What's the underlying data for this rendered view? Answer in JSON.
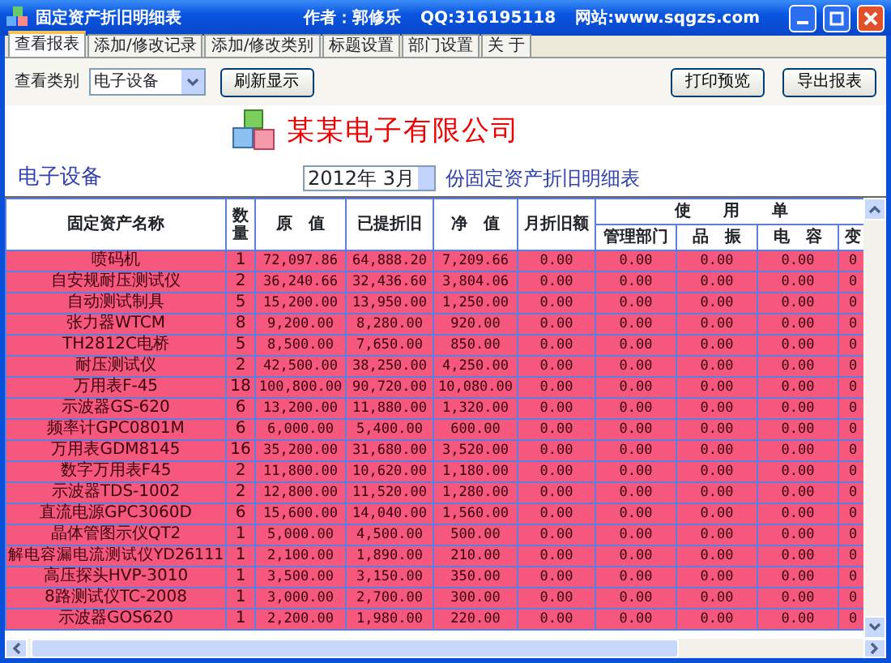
{
  "window": {
    "title": "固定资产折旧明细表",
    "author": "作者：郭修乐",
    "qq": "QQ:316195118",
    "website": "网站:www.sqgzs.com"
  },
  "tabs": [
    {
      "label": "查看报表",
      "selected": true
    },
    {
      "label": "添加/修改记录",
      "selected": false
    },
    {
      "label": "添加/修改类别",
      "selected": false
    },
    {
      "label": "标题设置",
      "selected": false
    },
    {
      "label": "部门设置",
      "selected": false
    },
    {
      "label": "关 于",
      "selected": false
    }
  ],
  "toolbar": {
    "category_label": "查看类别",
    "category_value": "电子设备",
    "refresh_button": "刷新显示",
    "print_preview_button": "打印预览",
    "export_button": "导出报表"
  },
  "report": {
    "company": "某某电子有限公司",
    "category": "电子设备",
    "date": "2012年 3月",
    "subtitle": "份固定资产折旧明细表",
    "table": {
      "columns": [
        "固定资产名称",
        "数量",
        "原　值",
        "已提折旧",
        "净　值",
        "月折旧额"
      ],
      "group_header": "使　　用　　单",
      "subcolumns": [
        "管理部门",
        "品　振",
        "电　容",
        "变"
      ],
      "rows": [
        [
          "喷码机",
          "1",
          "72,097.86",
          "64,888.20",
          "7,209.66",
          "0.00",
          "0.00",
          "0.00",
          "0.00",
          "0"
        ],
        [
          "自安规耐压测试仪",
          "2",
          "36,240.66",
          "32,436.60",
          "3,804.06",
          "0.00",
          "0.00",
          "0.00",
          "0.00",
          "0"
        ],
        [
          "自动测试制具",
          "5",
          "15,200.00",
          "13,950.00",
          "1,250.00",
          "0.00",
          "0.00",
          "0.00",
          "0.00",
          "0"
        ],
        [
          "张力器WTCM",
          "8",
          "9,200.00",
          "8,280.00",
          "920.00",
          "0.00",
          "0.00",
          "0.00",
          "0.00",
          "0"
        ],
        [
          "TH2812C电桥",
          "5",
          "8,500.00",
          "7,650.00",
          "850.00",
          "0.00",
          "0.00",
          "0.00",
          "0.00",
          "0"
        ],
        [
          "耐压测试仪",
          "2",
          "42,500.00",
          "38,250.00",
          "4,250.00",
          "0.00",
          "0.00",
          "0.00",
          "0.00",
          "0"
        ],
        [
          "万用表F-45",
          "18",
          "100,800.00",
          "90,720.00",
          "10,080.00",
          "0.00",
          "0.00",
          "0.00",
          "0.00",
          "0"
        ],
        [
          "示波器GS-620",
          "6",
          "13,200.00",
          "11,880.00",
          "1,320.00",
          "0.00",
          "0.00",
          "0.00",
          "0.00",
          "0"
        ],
        [
          "频率计GPC0801M",
          "6",
          "6,000.00",
          "5,400.00",
          "600.00",
          "0.00",
          "0.00",
          "0.00",
          "0.00",
          "0"
        ],
        [
          "万用表GDM8145",
          "16",
          "35,200.00",
          "31,680.00",
          "3,520.00",
          "0.00",
          "0.00",
          "0.00",
          "0.00",
          "0"
        ],
        [
          "数字万用表F45",
          "2",
          "11,800.00",
          "10,620.00",
          "1,180.00",
          "0.00",
          "0.00",
          "0.00",
          "0.00",
          "0"
        ],
        [
          "示波器TDS-1002",
          "2",
          "12,800.00",
          "11,520.00",
          "1,280.00",
          "0.00",
          "0.00",
          "0.00",
          "0.00",
          "0"
        ],
        [
          "直流电源GPC3060D",
          "6",
          "15,600.00",
          "14,040.00",
          "1,560.00",
          "0.00",
          "0.00",
          "0.00",
          "0.00",
          "0"
        ],
        [
          "晶体管图示仪QT2",
          "1",
          "5,000.00",
          "4,500.00",
          "500.00",
          "0.00",
          "0.00",
          "0.00",
          "0.00",
          "0"
        ],
        [
          "解电容漏电流测试仪YD26111",
          "1",
          "2,100.00",
          "1,890.00",
          "210.00",
          "0.00",
          "0.00",
          "0.00",
          "0.00",
          "0"
        ],
        [
          "高压探头HVP-3010",
          "1",
          "3,500.00",
          "3,150.00",
          "350.00",
          "0.00",
          "0.00",
          "0.00",
          "0.00",
          "0"
        ],
        [
          "8路测试仪TC-2008",
          "1",
          "3,000.00",
          "2,700.00",
          "300.00",
          "0.00",
          "0.00",
          "0.00",
          "0.00",
          "0"
        ],
        [
          "示波器GOS620",
          "1",
          "2,200.00",
          "1,980.00",
          "220.00",
          "0.00",
          "0.00",
          "0.00",
          "0.00",
          "0"
        ]
      ]
    }
  }
}
